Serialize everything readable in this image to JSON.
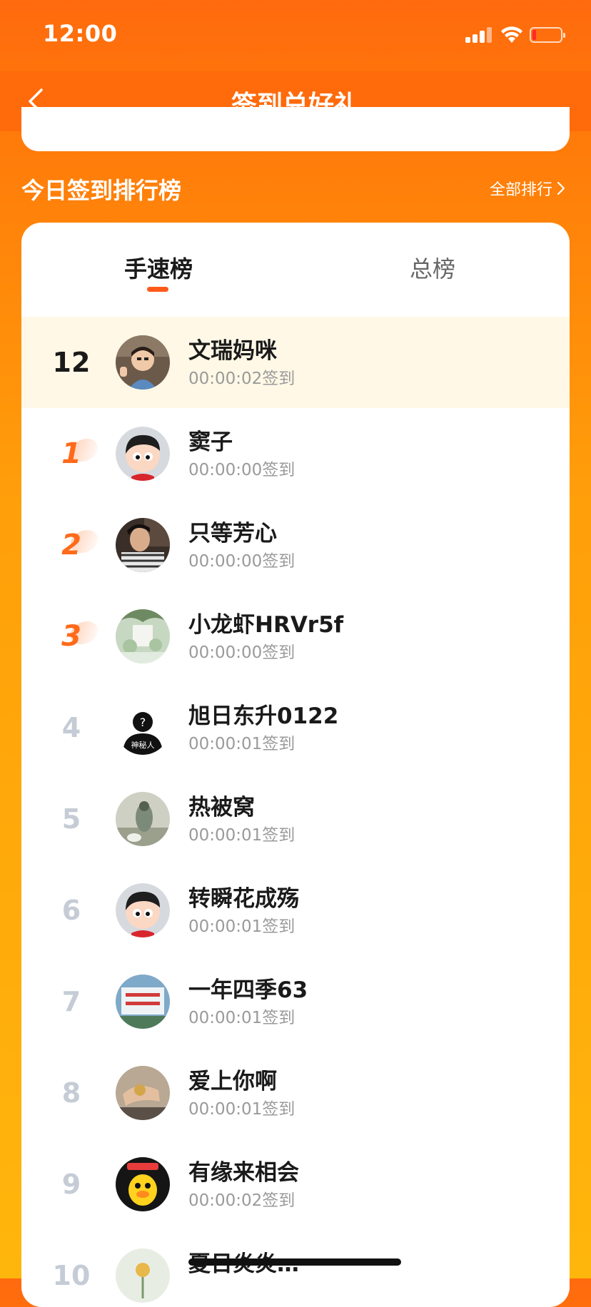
{
  "status": {
    "time": "12:00"
  },
  "nav": {
    "title": "签到兑好礼"
  },
  "section": {
    "title": "今日签到排行榜",
    "link": "全部排行"
  },
  "tabs": [
    {
      "label": "手速榜",
      "active": true
    },
    {
      "label": "总榜",
      "active": false
    }
  ],
  "my_row": {
    "rank": "12",
    "name": "文瑞妈咪",
    "time": "00:00:02签到"
  },
  "rows": [
    {
      "rank": "1",
      "name": "窦子",
      "time": "00:00:00签到",
      "avatar": "cartoon-boy"
    },
    {
      "rank": "2",
      "name": "只等芳心",
      "time": "00:00:00签到",
      "avatar": "photo-man"
    },
    {
      "rank": "3",
      "name": "小龙虾HRVr5f",
      "time": "00:00:00签到",
      "avatar": "photo-scenery"
    },
    {
      "rank": "4",
      "name": "旭日东升0122",
      "time": "00:00:01签到",
      "avatar": "mystery-person"
    },
    {
      "rank": "5",
      "name": "热被窝",
      "time": "00:00:01签到",
      "avatar": "photo-bird"
    },
    {
      "rank": "6",
      "name": "转瞬花成殇",
      "time": "00:00:01签到",
      "avatar": "cartoon-boy"
    },
    {
      "rank": "7",
      "name": "一年四季63",
      "time": "00:00:01签到",
      "avatar": "photo-sign"
    },
    {
      "rank": "8",
      "name": "爱上你啊",
      "time": "00:00:01签到",
      "avatar": "photo-hand"
    },
    {
      "rank": "9",
      "name": "有缘来相会",
      "time": "00:00:02签到",
      "avatar": "cartoon-duck"
    },
    {
      "rank": "10",
      "name": "夏日炎炎…",
      "time": "",
      "avatar": "photo-flower"
    }
  ],
  "colors": {
    "brand_orange": "#ff6a0a",
    "rank_top": "#ff6a1a",
    "rank_normal": "#c5ccd6",
    "highlight_row": "#fff8e6"
  }
}
